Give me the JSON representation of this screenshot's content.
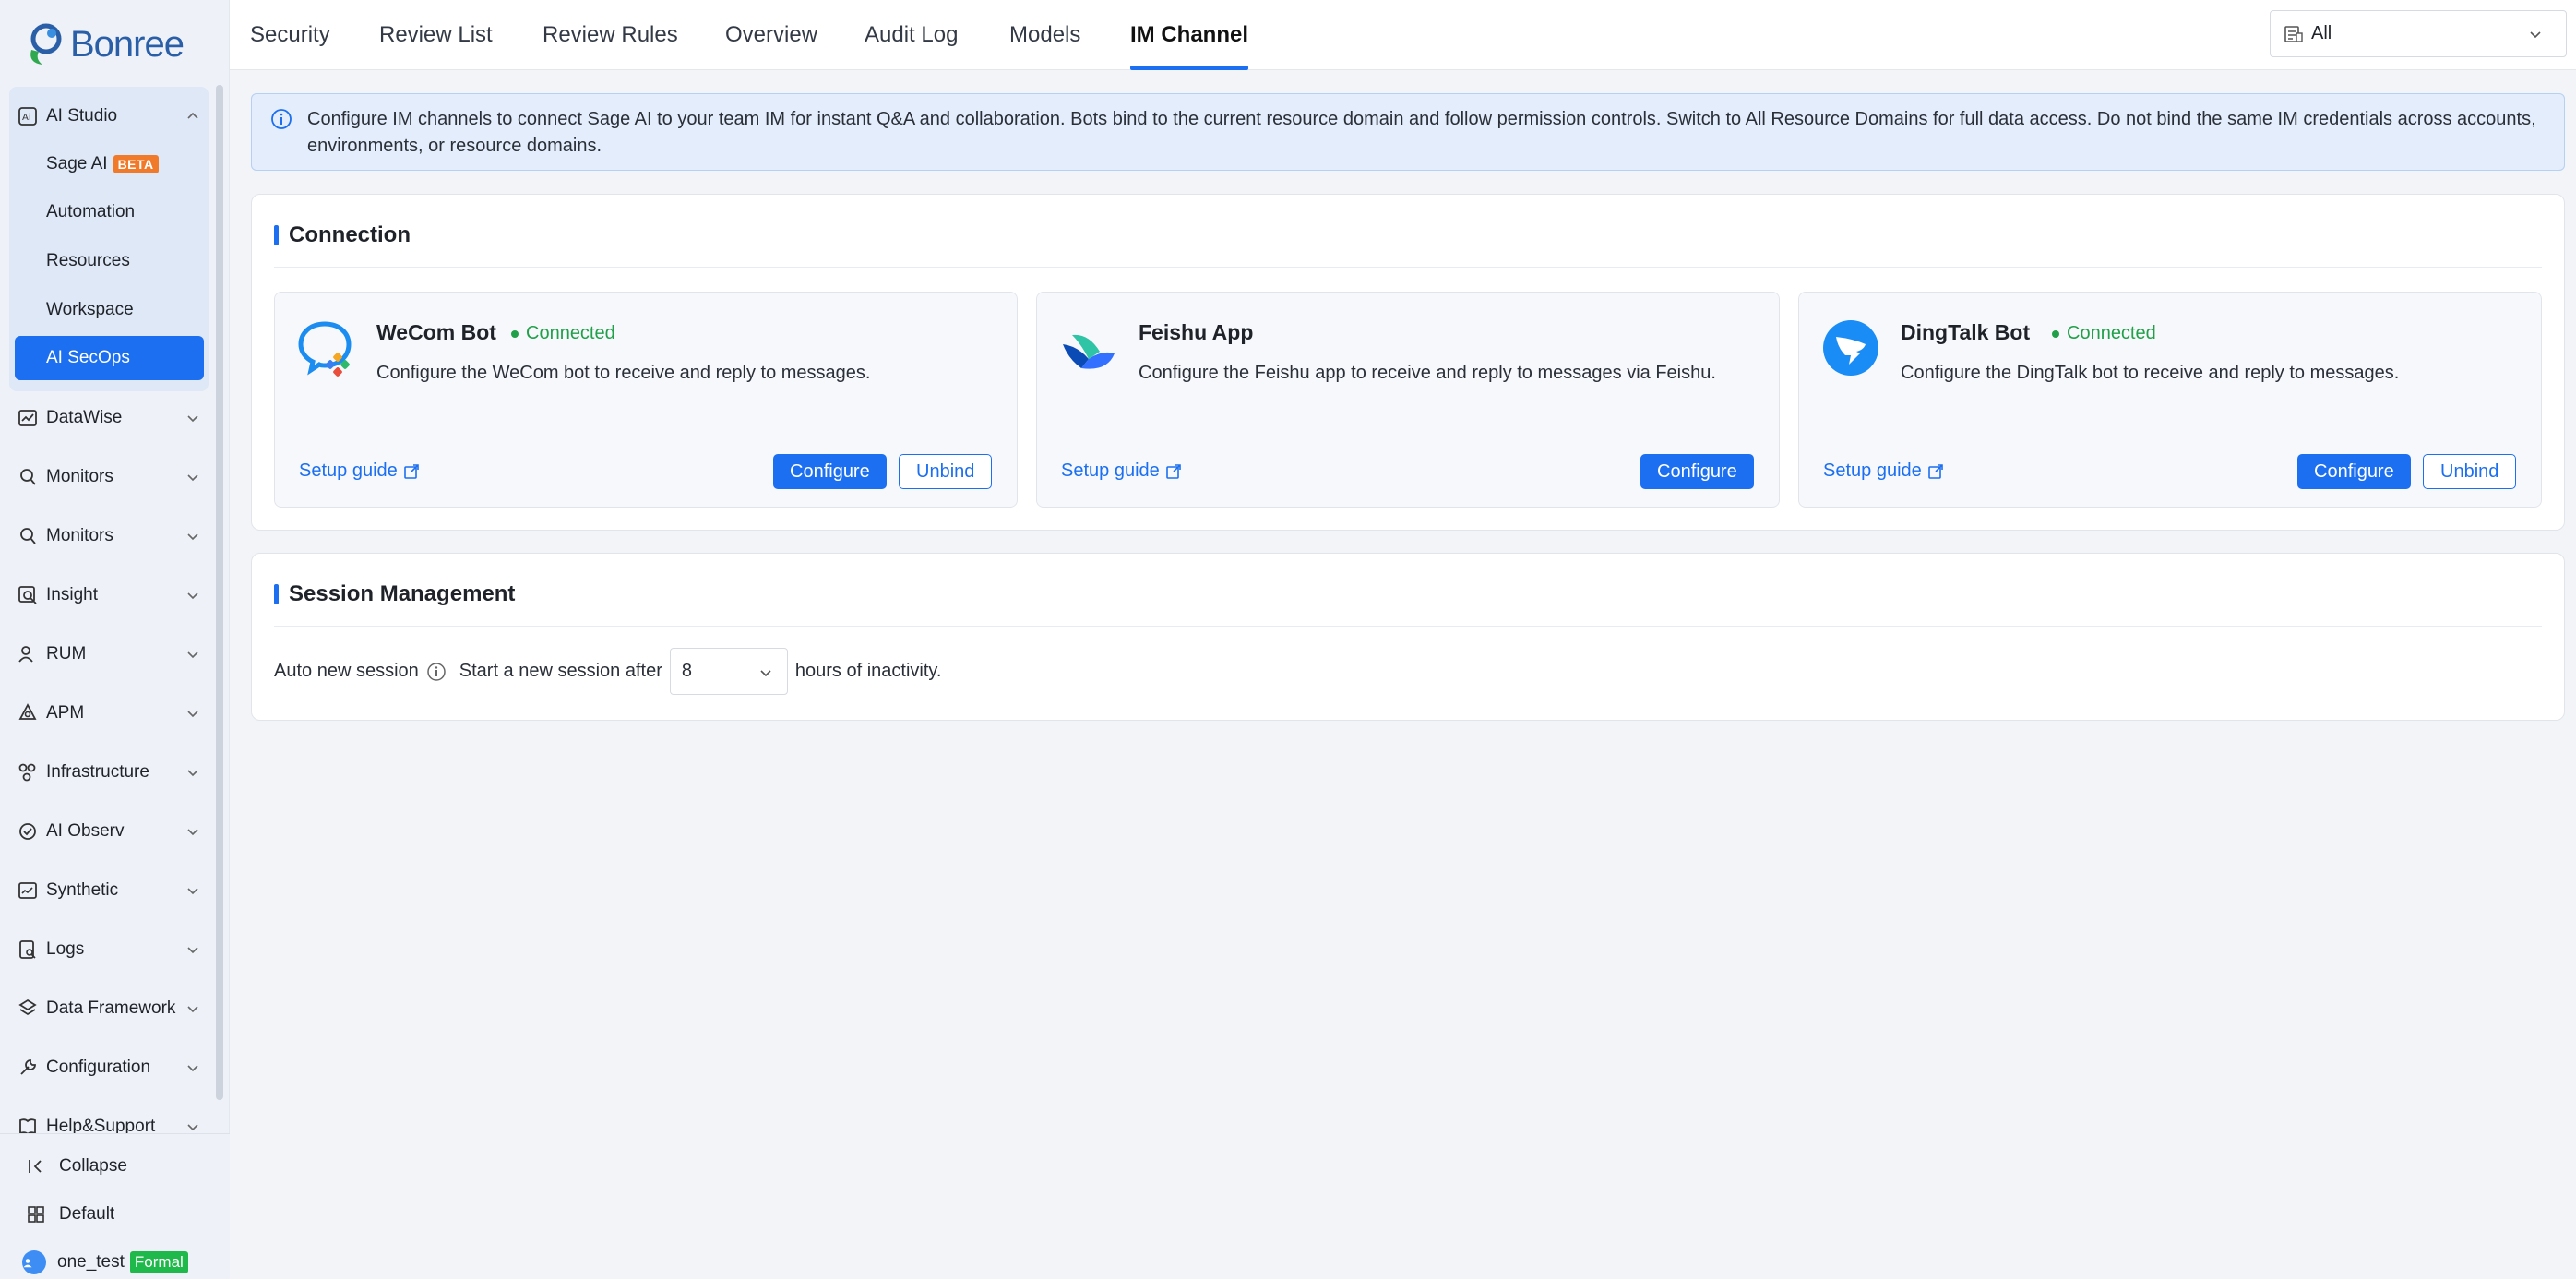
{
  "brand": {
    "name": "Bonree"
  },
  "sidebar": {
    "studio": {
      "label": "AI Studio",
      "items": [
        {
          "label": "Sage AI",
          "badge": "BETA"
        },
        {
          "label": "Automation"
        },
        {
          "label": "Resources"
        },
        {
          "label": "Workspace"
        },
        {
          "label": "AI SecOps"
        }
      ]
    },
    "groups": [
      {
        "label": "DataWise"
      },
      {
        "label": "Monitors"
      },
      {
        "label": "Monitors"
      },
      {
        "label": "Insight"
      },
      {
        "label": "RUM"
      },
      {
        "label": "APM"
      },
      {
        "label": "Infrastructure"
      },
      {
        "label": "AI Observ"
      },
      {
        "label": "Synthetic"
      },
      {
        "label": "Logs"
      },
      {
        "label": "Data Framework"
      },
      {
        "label": "Configuration"
      },
      {
        "label": "Help&Support"
      }
    ],
    "bottom": {
      "collapse": "Collapse",
      "workspace": "Default",
      "user": "one_test",
      "env_badge": "Formal"
    }
  },
  "tabs": [
    {
      "label": "Security"
    },
    {
      "label": "Review List"
    },
    {
      "label": "Review Rules"
    },
    {
      "label": "Overview"
    },
    {
      "label": "Audit Log"
    },
    {
      "label": "Models"
    },
    {
      "label": "IM Channel",
      "active": true
    }
  ],
  "domain_select": {
    "value": "All"
  },
  "alert": {
    "text": "Configure IM channels to connect Sage AI to your team IM for instant Q&A and collaboration. Bots bind to the current resource domain and follow permission controls. Switch to All Resource Domains for full data access. Do not bind the same IM credentials across accounts, environments, or resource domains."
  },
  "connection": {
    "title": "Connection",
    "channels": [
      {
        "name": "WeCom Bot",
        "status": "Connected",
        "description": "Configure the WeCom bot to receive and reply to messages.",
        "guide": "Setup guide",
        "configure": "Configure",
        "unbind": "Unbind"
      },
      {
        "name": "Feishu App",
        "description": "Configure the Feishu app to receive and reply to messages via Feishu.",
        "guide": "Setup guide",
        "configure": "Configure"
      },
      {
        "name": "DingTalk Bot",
        "status": "Connected",
        "description": "Configure the DingTalk bot to receive and reply to messages.",
        "guide": "Setup guide",
        "configure": "Configure",
        "unbind": "Unbind"
      }
    ]
  },
  "session": {
    "title": "Session Management",
    "label": "Auto new session",
    "prefix": "Start a new session after",
    "hours": "8",
    "suffix": "hours of inactivity."
  },
  "colors": {
    "accent": "#1b6ff0",
    "connected": "#21a04a",
    "beta": "#f07a2a",
    "formal": "#1fb84a"
  }
}
